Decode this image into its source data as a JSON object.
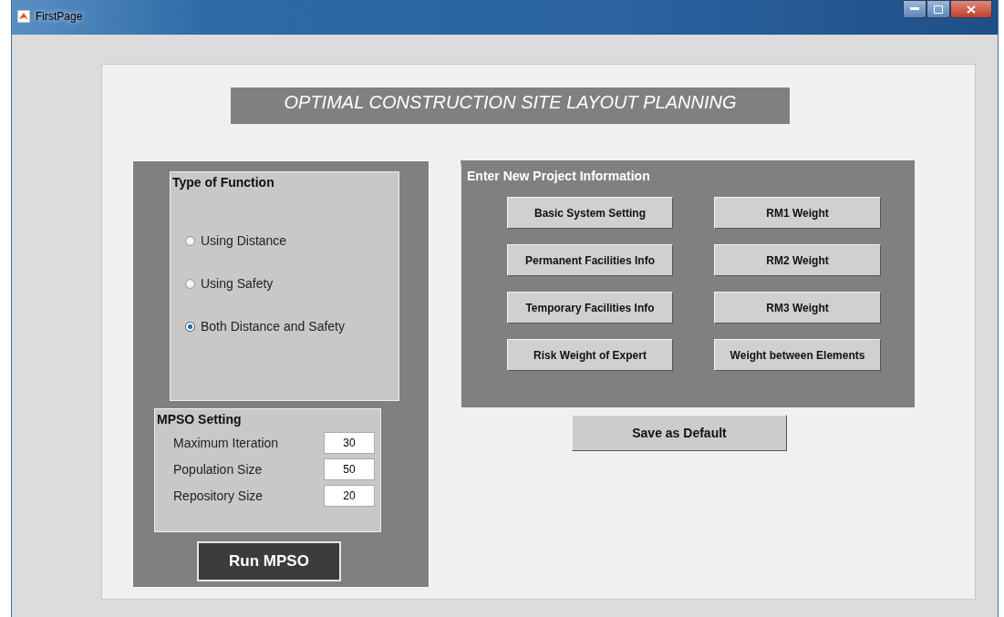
{
  "window": {
    "title": "FirstPage"
  },
  "banner": "OPTIMAL CONSTRUCTION SITE LAYOUT PLANNING",
  "function_group": {
    "title": "Type of Function",
    "options": [
      {
        "label": "Using Distance",
        "selected": false
      },
      {
        "label": "Using Safety",
        "selected": false
      },
      {
        "label": "Both Distance and Safety",
        "selected": true
      }
    ]
  },
  "mpso_group": {
    "title": "MPSO Setting",
    "fields": [
      {
        "label": "Maximum Iteration",
        "value": "30"
      },
      {
        "label": "Population Size",
        "value": "50"
      },
      {
        "label": "Repository Size",
        "value": "20"
      }
    ]
  },
  "run_button": "Run MPSO",
  "project_group": {
    "title": "Enter New Project Information",
    "buttons": [
      "Basic System Setting",
      "RM1 Weight",
      "Permanent Facilities Info",
      "RM2 Weight",
      "Temporary Facilities Info",
      "RM3 Weight",
      "Risk Weight of Expert",
      "Weight between Elements"
    ]
  },
  "save_button": "Save as Default"
}
